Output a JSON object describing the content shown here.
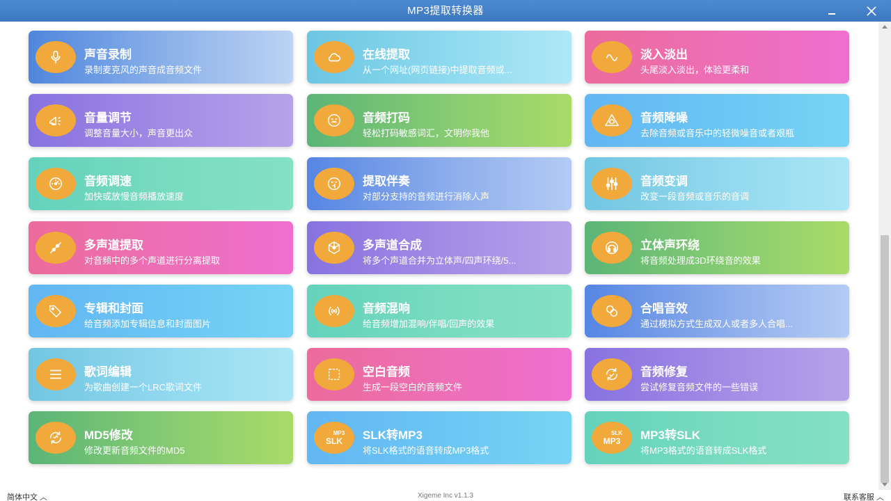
{
  "window": {
    "title": "MP3提取转换器"
  },
  "cards": [
    {
      "title": "声音录制",
      "desc": "录制麦克风的声音成音频文件",
      "icon": "microphone-icon",
      "gradient": "g-blue-light"
    },
    {
      "title": "在线提取",
      "desc": "从一个网址(网页链接)中提取音频或...",
      "icon": "cloud-icon",
      "gradient": "g-cyan"
    },
    {
      "title": "淡入淡出",
      "desc": "头尾淡入淡出，体验更柔和",
      "icon": "wave-icon",
      "gradient": "g-pink"
    },
    {
      "title": "音量调节",
      "desc": "调整音量大小，声音更出众",
      "icon": "megaphone-icon",
      "gradient": "g-purple"
    },
    {
      "title": "音频打码",
      "desc": "轻松打码敏感词汇，文明你我他",
      "icon": "face-icon",
      "gradient": "g-green"
    },
    {
      "title": "音频降噪",
      "desc": "去除音频或音乐中的轻微噪音或者艰瓶",
      "icon": "noise-reduction-icon",
      "gradient": "g-sky"
    },
    {
      "title": "音频调速",
      "desc": "加快或放慢音频播放速度",
      "icon": "speedometer-icon",
      "gradient": "g-teal"
    },
    {
      "title": "提取伴奏",
      "desc": "对部分支持的音频进行消除人声",
      "icon": "shush-face-icon",
      "gradient": "g-blue-deep"
    },
    {
      "title": "音频变调",
      "desc": "改变一段音频或音乐的音调",
      "icon": "sliders-icon",
      "gradient": "g-cyan2"
    },
    {
      "title": "多声道提取",
      "desc": "对音频中的多个声道进行分离提取",
      "icon": "split-icon",
      "gradient": "g-pink"
    },
    {
      "title": "多声道合成",
      "desc": "将多个声道合并为立体声/四声环绕/5...",
      "icon": "merge-icon",
      "gradient": "g-purple"
    },
    {
      "title": "立体声环绕",
      "desc": "将音频处理成3D环绕音的效果",
      "icon": "headphones-icon",
      "gradient": "g-green"
    },
    {
      "title": "专辑和封面",
      "desc": "给音频添加专辑信息和封面图片",
      "icon": "tag-icon",
      "gradient": "g-sky"
    },
    {
      "title": "音频混响",
      "desc": "给音频增加混响/伴唱/回声的效果",
      "icon": "reverb-icon",
      "gradient": "g-teal"
    },
    {
      "title": "合唱音效",
      "desc": "通过模拟方式生成双人或者多人合唱...",
      "icon": "chorus-icon",
      "gradient": "g-blue-deep"
    },
    {
      "title": "歌词编辑",
      "desc": "为歌曲创建一个LRC歌词文件",
      "icon": "lines-icon",
      "gradient": "g-cyan2"
    },
    {
      "title": "空白音频",
      "desc": "生成一段空白的音频文件",
      "icon": "blank-icon",
      "gradient": "g-pink"
    },
    {
      "title": "音频修复",
      "desc": "尝试修复音频文件的一些错误",
      "icon": "repair-icon",
      "gradient": "g-purple"
    },
    {
      "title": "MD5修改",
      "desc": "修改更新音频文件的MD5",
      "icon": "refresh-icon",
      "gradient": "g-green"
    },
    {
      "title": "SLK转MP3",
      "desc": "将SLK格式的语音转成MP3格式",
      "icon": "slk-to-mp3-icon",
      "icon_text_small": "MP3",
      "icon_text_big": "SLK",
      "gradient": "g-sky"
    },
    {
      "title": "MP3转SLK",
      "desc": "将MP3格式的语音转成SLK格式",
      "icon": "mp3-to-slk-icon",
      "icon_text_small": "SLK",
      "icon_text_big": "MP3",
      "gradient": "g-teal"
    }
  ],
  "status": {
    "language": "简体中文",
    "version": "Xigeme Inc v1.1.3",
    "service": "联系客服"
  }
}
